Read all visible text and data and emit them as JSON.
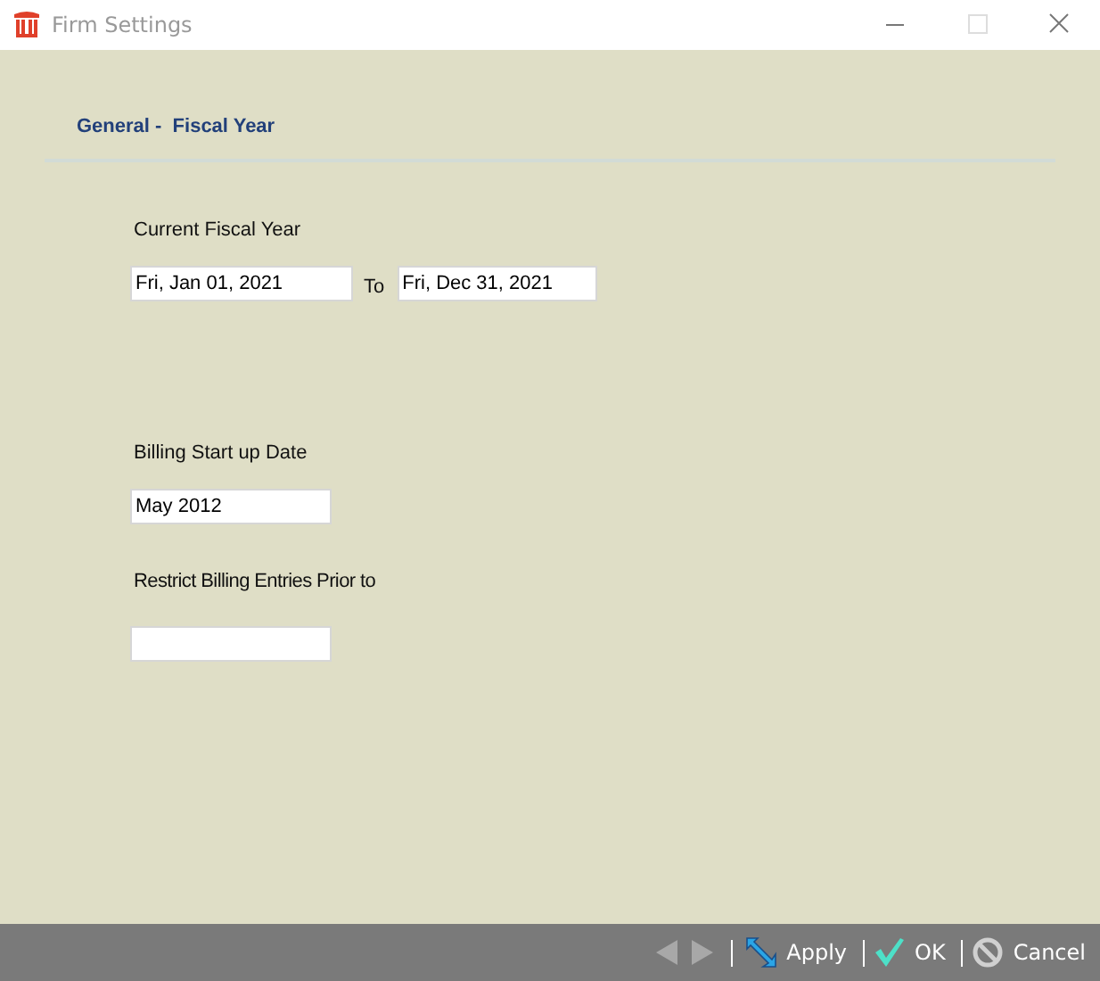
{
  "window": {
    "title": "Firm Settings",
    "controls": [
      {
        "kind": "minimize",
        "disabled": false
      },
      {
        "kind": "maximize",
        "disabled": true
      },
      {
        "kind": "close",
        "disabled": false
      }
    ]
  },
  "section_title": "General -  Fiscal Year",
  "fiscal_year": {
    "label": "Current Fiscal Year",
    "start": "Fri, Jan 01, 2021",
    "separator": "To",
    "end": "Fri, Dec 31, 2021"
  },
  "billing_start": {
    "label": "Billing Start up Date",
    "value": "May 2012"
  },
  "restrict_billing": {
    "label": "Restrict Billing Entries Prior to"
  },
  "nav": [
    {
      "kind": "prev",
      "disabled": true
    },
    {
      "kind": "next",
      "disabled": true
    }
  ],
  "buttons": [
    {
      "kind": "apply",
      "label": "Apply"
    },
    {
      "kind": "ok",
      "label": "OK"
    },
    {
      "kind": "cancel",
      "label": "Cancel"
    }
  ]
}
